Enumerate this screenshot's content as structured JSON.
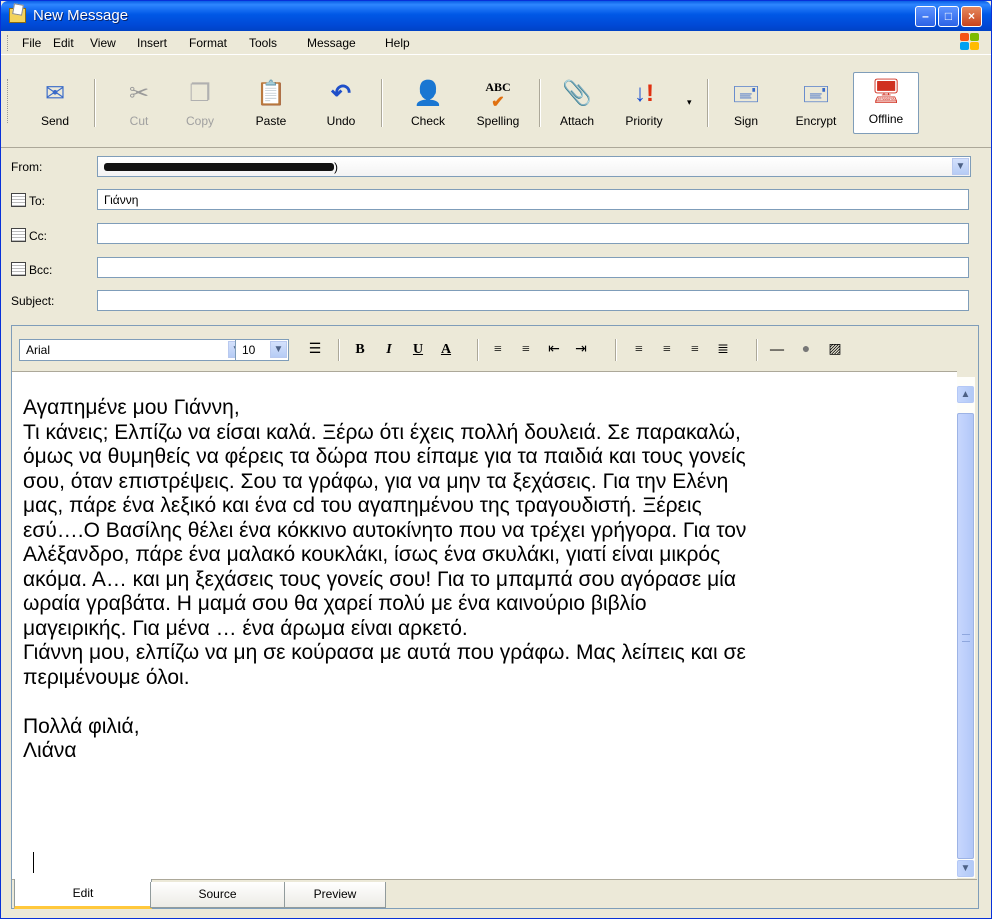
{
  "window": {
    "title": "New Message"
  },
  "menu": [
    "File",
    "Edit",
    "View",
    "Insert",
    "Format",
    "Tools",
    "Message",
    "Help"
  ],
  "toolbar": [
    {
      "label": "Send",
      "icon": "send-icon"
    },
    {
      "label": "Cut",
      "icon": "cut-icon",
      "disabled": true
    },
    {
      "label": "Copy",
      "icon": "copy-icon",
      "disabled": true
    },
    {
      "label": "Paste",
      "icon": "paste-icon"
    },
    {
      "label": "Undo",
      "icon": "undo-icon"
    },
    {
      "label": "Check",
      "icon": "check-names-icon"
    },
    {
      "label": "Spelling",
      "icon": "spelling-icon"
    },
    {
      "label": "Attach",
      "icon": "paperclip-icon"
    },
    {
      "label": "Priority",
      "icon": "priority-icon"
    },
    {
      "label": "Sign",
      "icon": "sign-icon"
    },
    {
      "label": "Encrypt",
      "icon": "encrypt-icon"
    },
    {
      "label": "Offline",
      "icon": "offline-icon"
    }
  ],
  "fields": {
    "from_label": "From:",
    "from_suffix": ")",
    "to_label": "To:",
    "to_value": "Γιάννη",
    "cc_label": "Cc:",
    "bcc_label": "Bcc:",
    "subject_label": "Subject:"
  },
  "format": {
    "font": "Arial",
    "size": "10"
  },
  "body": [
    "Αγαπημένε μου Γιάννη,",
    "Τι κάνεις;  Ελπίζω να είσαι καλά. Ξέρω ότι έχεις πολλή δουλειά. Σε παρακαλώ,",
    "όμως να θυμηθείς να φέρεις τα δώρα που είπαμε για τα παιδιά και τους γονείς",
    "σου, όταν επιστρέψεις. Σου τα  γράφω, για να μην τα ξεχάσεις. Για την Ελένη",
    "μας, πάρε ένα λεξικό και ένα cd του αγαπημένου της τραγουδιστή. Ξέρεις",
    "εσύ….Ο Βασίλης θέλει ένα κόκκινο αυτοκίνητο που να τρέχει γρήγορα. Για τον",
    "Αλέξανδρο, πάρε  ένα μαλακό κουκλάκι, ίσως ένα σκυλάκι, γιατί είναι μικρός",
    "ακόμα. Α… και μη ξεχάσεις τους γονείς σου! Για το μπαμπά σου αγόρασε μία",
    "ωραία γραβάτα. Η μαμά σου θα χαρεί πολύ με ένα καινούριο βιβλίο",
    "μαγειρικής. Για μένα … ένα άρωμα είναι αρκετό.",
    "Γιάννη μου, ελπίζω να μη σε κούρασα με αυτά που γράφω. Μας λείπεις και σε",
    "περιμένουμε όλοι.",
    "",
    "Πολλά φιλιά,",
    "Λιάνα"
  ],
  "tabs": [
    "Edit",
    "Source",
    "Preview"
  ]
}
